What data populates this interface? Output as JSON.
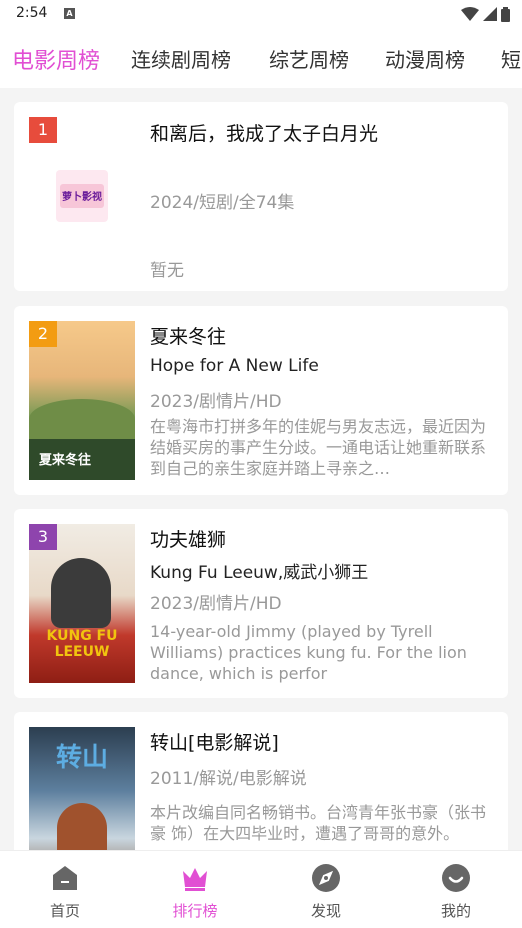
{
  "status_bar": {
    "time": "2:54",
    "notification_letter": "A"
  },
  "tabs": [
    {
      "label": "电影周榜",
      "active": true
    },
    {
      "label": "连续剧周榜",
      "active": false
    },
    {
      "label": "综艺周榜",
      "active": false
    },
    {
      "label": "动漫周榜",
      "active": false
    },
    {
      "label": "短",
      "active": false
    }
  ],
  "items": [
    {
      "rank": "1",
      "rank_color": "#e74c3c",
      "title": "和离后，我成了太子白月光",
      "info": "2024/短剧/全74集",
      "desc": "暂无",
      "logo_text": "萝卜影视"
    },
    {
      "rank": "2",
      "rank_color": "#f39c12",
      "title": "夏来冬往",
      "subtitle": "Hope for A New Life",
      "info": "2023/剧情片/HD",
      "desc": "在粤海市打拼多年的佳妮与男友志远，最近因为结婚买房的事产生分歧。一通电话让她重新联系到自己的亲生家庭并踏上寻亲之…",
      "poster_text": "夏来冬往"
    },
    {
      "rank": "3",
      "rank_color": "#8e44ad",
      "title": "功夫雄狮",
      "subtitle": "Kung Fu Leeuw,威武小狮王",
      "info": "2023/剧情片/HD",
      "desc": "14-year-old Jimmy (played by Tyrell Williams) practices kung fu. For the lion dance, which is perfor",
      "poster_text": "KUNG FU LEEUW"
    },
    {
      "title": "转山[电影解说]",
      "info": "2011/解说/电影解说",
      "desc": "本片改编自同名畅销书。台湾青年张书豪（张书豪 饰）在大四毕业时，遭遇了哥哥的意外。",
      "poster_text": "转山"
    }
  ],
  "bottom_nav": [
    {
      "label": "首页",
      "icon": "home-icon",
      "active": false
    },
    {
      "label": "排行榜",
      "icon": "crown-icon",
      "active": true
    },
    {
      "label": "发现",
      "icon": "discover-icon",
      "active": false
    },
    {
      "label": "我的",
      "icon": "profile-icon",
      "active": false
    }
  ],
  "accent_color": "#e14fd3"
}
